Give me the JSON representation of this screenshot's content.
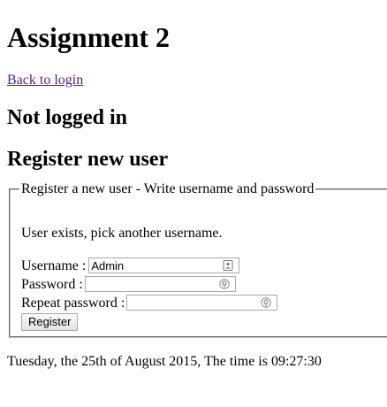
{
  "page": {
    "title": "Assignment 2",
    "back_link": "Back to login",
    "status": "Not logged in",
    "section_title": "Register new user"
  },
  "form": {
    "legend": "Register a new user - Write username and password",
    "message": "User exists, pick another username.",
    "username_label": "Username :",
    "username_value": "Admin",
    "password_label": "Password :",
    "password_value": "",
    "repeat_password_label": "Repeat password :",
    "repeat_password_value": "",
    "register_button": "Register",
    "icons": {
      "username": "contact-card-icon",
      "password": "password-key-icon",
      "repeat_password": "password-key-icon"
    }
  },
  "footer": {
    "datetime": "Tuesday, the 25th of August 2015, The time is 09:27:30"
  },
  "colors": {
    "link": "#551a8b",
    "border": "#a9a9a9"
  }
}
